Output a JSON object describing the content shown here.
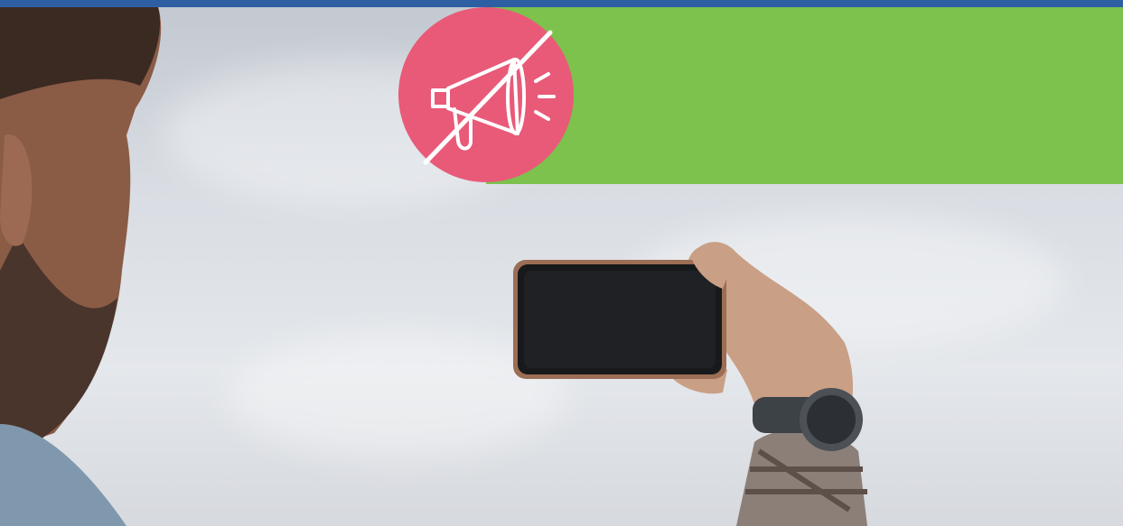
{
  "colors": {
    "top_bar": "#2f5fa3",
    "banner": "#7cc24d",
    "badge": "#e85a78",
    "sky": "#dfe3e8"
  },
  "badge": {
    "icon": "megaphone-crossed-out-icon"
  },
  "photo": {
    "subject": "person-holding-smartphone-against-sky"
  }
}
